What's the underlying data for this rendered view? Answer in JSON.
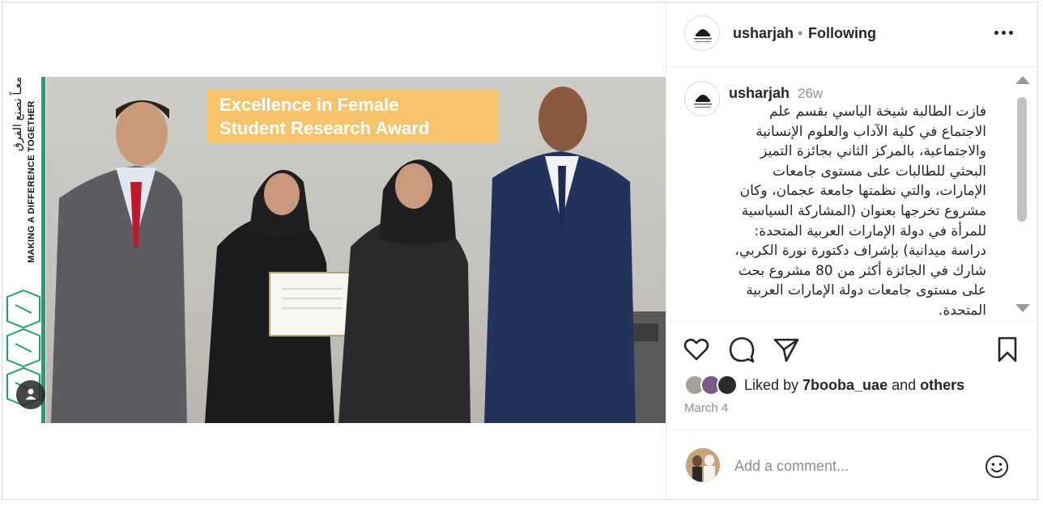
{
  "media": {
    "award_line1": "Excellence in Female",
    "award_line2": "Student Research Award",
    "side_text_en": "MAKING A DIFFERENCE TOGETHER",
    "side_text_ar": "معـاً نصنع الفرق"
  },
  "header": {
    "username": "usharjah",
    "separator": "•",
    "follow_status": "Following",
    "more_icon": "more-horizontal-icon"
  },
  "caption": {
    "username": "usharjah",
    "time_ago": "26w",
    "text": "فازت الطالبة شيخة الياسي بقسم علم الاجتماع في كلية الآداب والعلوم الإنسانية والاجتماعية، بالمركز الثاني بجائزة التميز البحثي للطالبات على مستوى جامعات الإمارات، والتي نظمتها جامعة عجمان، وكان مشروع تخرجها بعنوان (المشاركة السياسية للمرأة في دولة الإمارات العربية المتحدة: دراسة ميدانية) بإشراف دكتورة نورة الكربي، شارك في الجائزة أكثر من 80 مشروع بحث على مستوى جامعات دولة الإمارات العربية المتحدة."
  },
  "actions": {
    "icons": [
      "heart-icon",
      "comment-icon",
      "share-icon",
      "bookmark-icon"
    ]
  },
  "likes": {
    "prefix": "Liked by ",
    "user": "7booba_uae",
    "conj": " and ",
    "others": "others"
  },
  "date": "March 4",
  "comment": {
    "placeholder": "Add a comment...",
    "emoji_icon": "emoji-icon"
  },
  "colors": {
    "banner_green": "#1fa36b",
    "award_board": "#f7c46c",
    "text_primary": "#262626",
    "text_secondary": "#8e8e8e"
  }
}
